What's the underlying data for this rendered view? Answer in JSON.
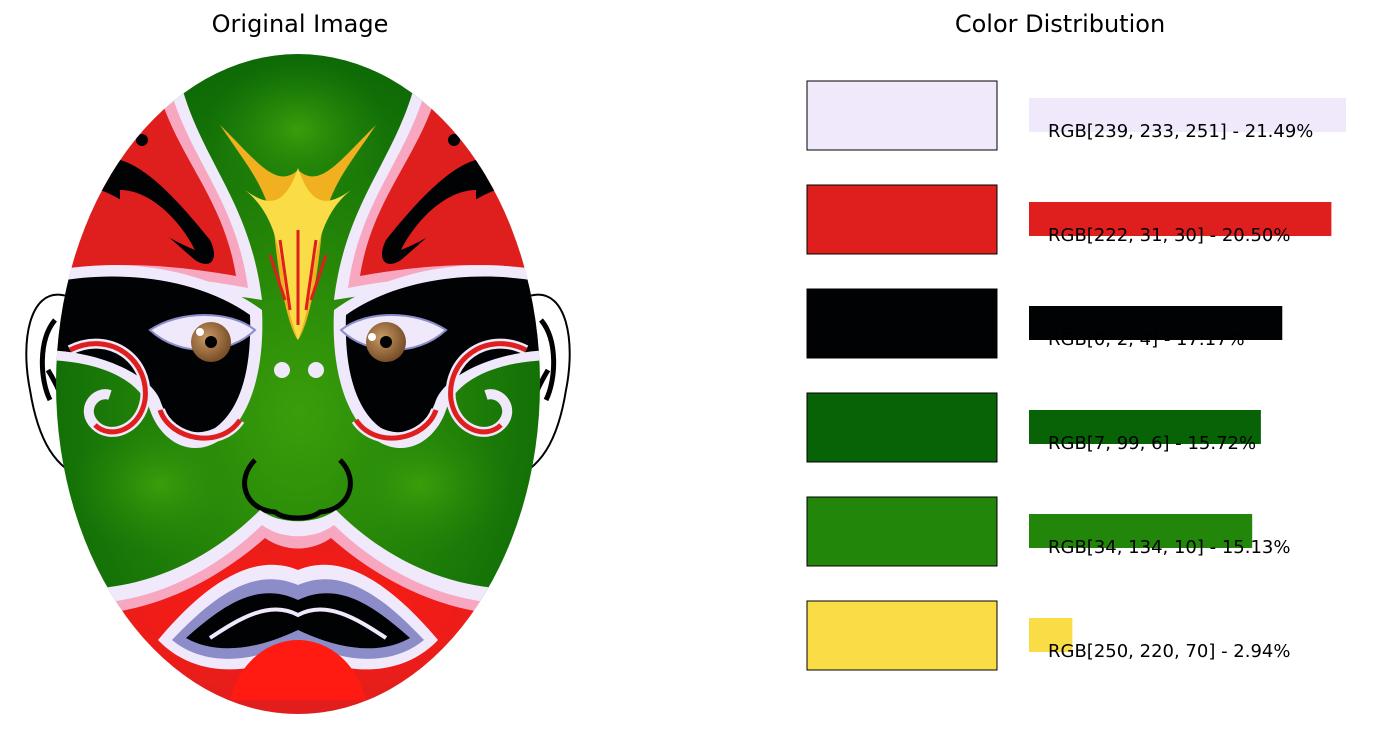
{
  "left_panel": {
    "title": "Original Image"
  },
  "right_panel": {
    "title": "Color Distribution"
  },
  "chart_data": {
    "type": "bar",
    "orientation": "horizontal",
    "title": "Color Distribution",
    "categories": [
      "RGB[239, 233, 251] - 21.49%",
      "RGB[222, 31, 30] - 20.50%",
      "RGB[0, 2, 4] - 17.17%",
      "RGB[7, 99, 6] - 15.72%",
      "RGB[34, 134, 10] - 15.13%",
      "RGB[250, 220, 70] - 2.94%"
    ],
    "values": [
      21.49,
      20.5,
      17.17,
      15.72,
      15.13,
      2.94
    ],
    "colors": [
      "#efe9fb",
      "#de1f1e",
      "#000204",
      "#076306",
      "#22860a",
      "#fadc46"
    ],
    "grid": false,
    "axes_visible": false
  },
  "mask_colors": {
    "green": "#22860a",
    "green_light": "#3a9e0a",
    "green_dark": "#076306",
    "red": "#de1f1e",
    "black": "#000204",
    "lavender": "#efe9fb",
    "pink": "#f7a8c0",
    "yellow": "#fadc46",
    "orange": "#f0b020",
    "purple": "#8c8cc8",
    "eye_brown": "#9c6a3a"
  }
}
